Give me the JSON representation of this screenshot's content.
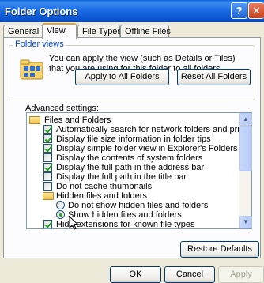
{
  "window": {
    "title": "Folder Options",
    "help_glyph": "?",
    "close_glyph": "✕"
  },
  "tabs": [
    {
      "label": "General",
      "active": false
    },
    {
      "label": "View",
      "active": true
    },
    {
      "label": "File Types",
      "active": false
    },
    {
      "label": "Offline Files",
      "active": false
    }
  ],
  "folder_views": {
    "legend": "Folder views",
    "description": "You can apply the view (such as Details or Tiles) that you are using for this folder to all folders.",
    "apply_all_label": "Apply to All Folders",
    "reset_all_label": "Reset All Folders"
  },
  "advanced": {
    "label": "Advanced settings:",
    "items": [
      {
        "type": "folder",
        "label": "Files and Folders"
      },
      {
        "type": "checkbox",
        "checked": true,
        "label": "Automatically search for network folders and printers"
      },
      {
        "type": "checkbox",
        "checked": true,
        "label": "Display file size information in folder tips"
      },
      {
        "type": "checkbox",
        "checked": true,
        "label": "Display simple folder view in Explorer's Folders list"
      },
      {
        "type": "checkbox",
        "checked": false,
        "label": "Display the contents of system folders"
      },
      {
        "type": "checkbox",
        "checked": true,
        "label": "Display the full path in the address bar"
      },
      {
        "type": "checkbox",
        "checked": false,
        "label": "Display the full path in the title bar"
      },
      {
        "type": "checkbox",
        "checked": false,
        "label": "Do not cache thumbnails"
      },
      {
        "type": "folder",
        "label": "Hidden files and folders"
      },
      {
        "type": "radio",
        "checked": false,
        "label": "Do not show hidden files and folders"
      },
      {
        "type": "radio",
        "checked": true,
        "label": "Show hidden files and folders"
      },
      {
        "type": "checkbox",
        "checked": true,
        "label": "Hide extensions for known file types"
      }
    ]
  },
  "scroll": {
    "up_glyph": "▲",
    "down_glyph": "▼"
  },
  "buttons": {
    "restore_defaults": "Restore Defaults",
    "ok": "OK",
    "cancel": "Cancel",
    "apply": "Apply"
  }
}
